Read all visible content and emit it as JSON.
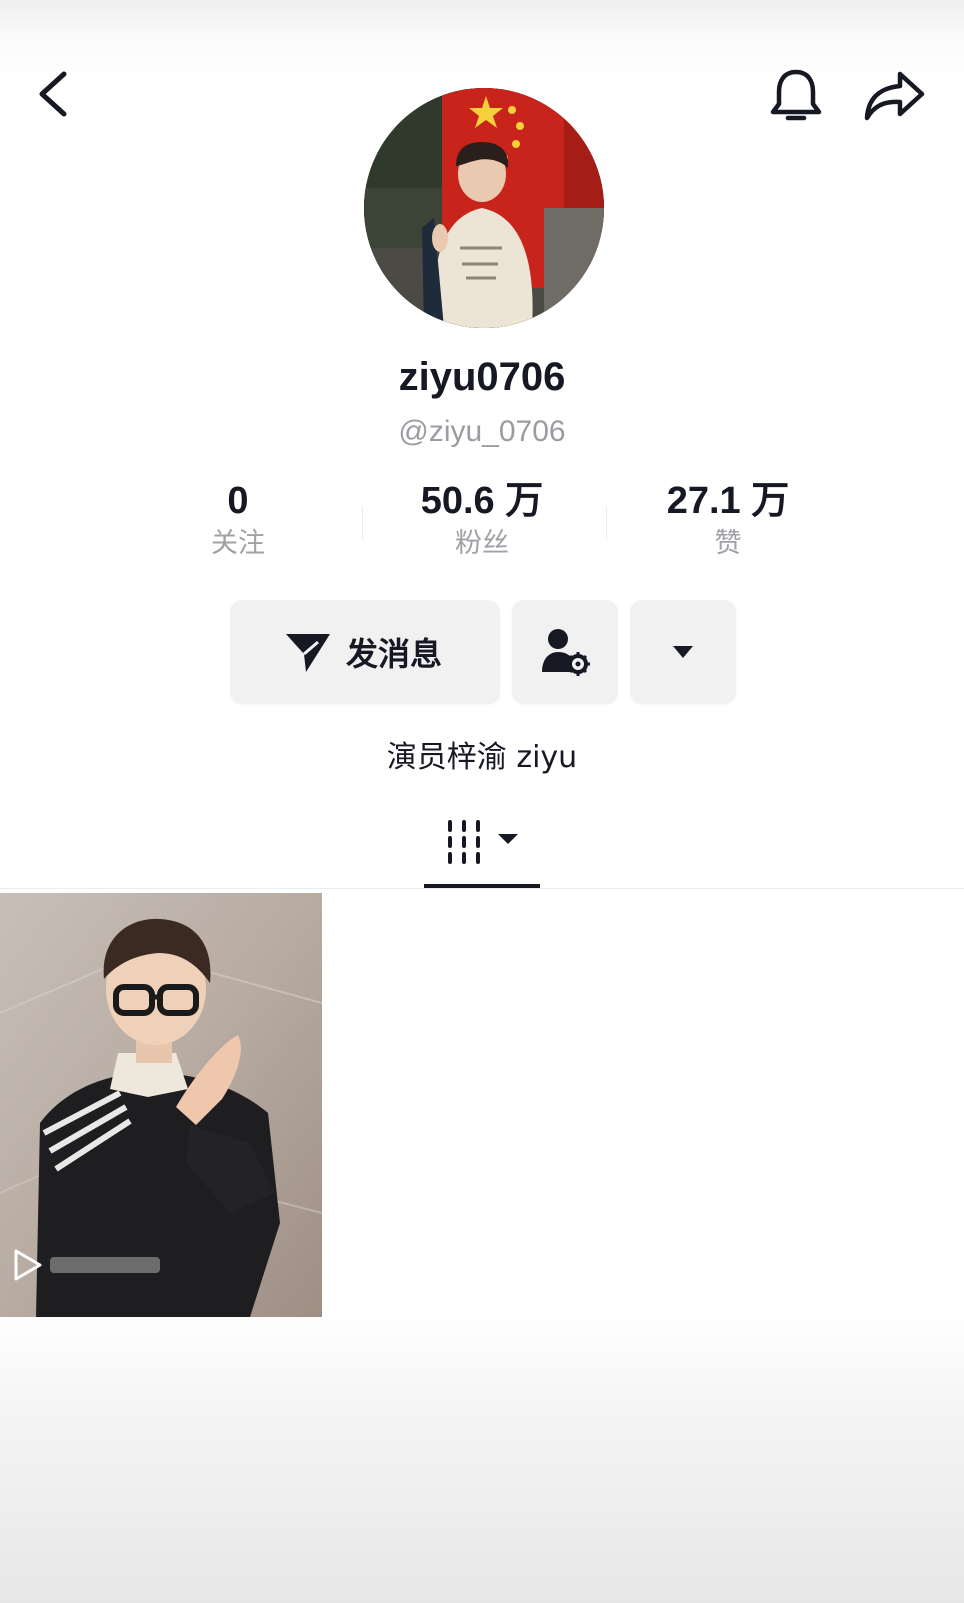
{
  "header": {
    "back_icon": "chevron-left-icon",
    "bell_icon": "bell-icon",
    "share_icon": "share-arrow-icon"
  },
  "profile": {
    "nickname": "ziyu0706",
    "handle": "@ziyu_0706",
    "bio": "演员梓渝 ziyu"
  },
  "stats": [
    {
      "value": "0",
      "label": "关注"
    },
    {
      "value": "50.6 万",
      "label": "粉丝"
    },
    {
      "value": "27.1 万",
      "label": "赞"
    }
  ],
  "actions": {
    "message_label": "发消息",
    "message_icon": "send-icon",
    "settings_icon": "user-settings-icon",
    "more_icon": "caret-down-icon"
  },
  "tabs": {
    "active_icon": "grid-columns-icon"
  },
  "videos": [
    {
      "icon": "play-icon"
    }
  ],
  "colors": {
    "text_primary": "#161823",
    "text_secondary": "#9b9ca1",
    "button_bg": "#f1f1f2"
  }
}
